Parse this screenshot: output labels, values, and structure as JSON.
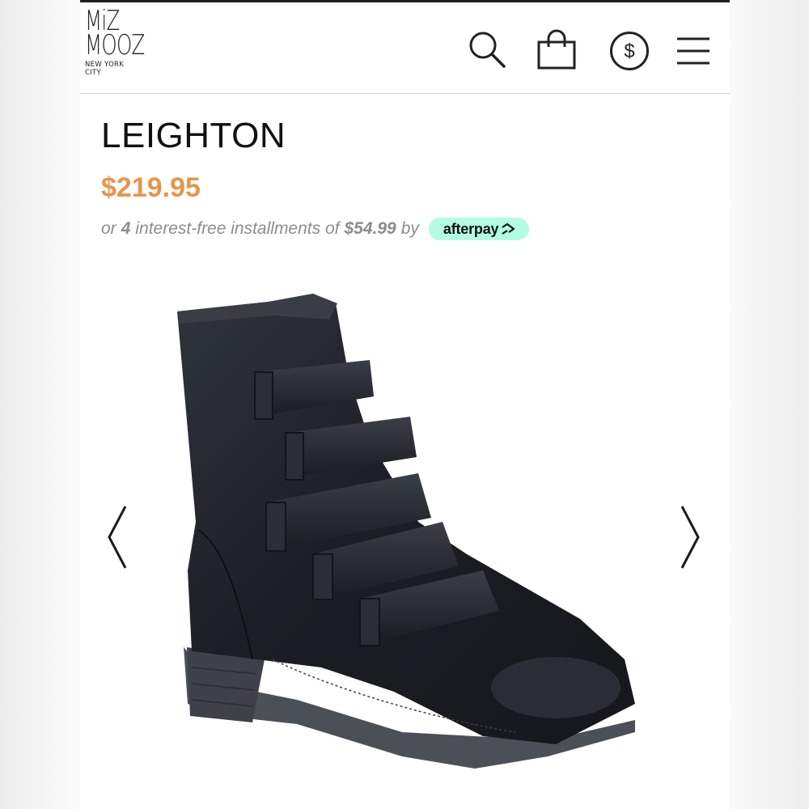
{
  "brand": {
    "logo_line1": "MiZ",
    "logo_line2": "MOOZ",
    "logo_tagline": "NEW YORK CITY"
  },
  "header": {
    "icons": [
      "search-icon",
      "shopping-bag-icon",
      "currency-icon",
      "menu-icon"
    ],
    "currency_symbol": "$"
  },
  "product": {
    "name": "LEIGHTON",
    "price": "$219.95",
    "installments": {
      "prefix": "or",
      "count": "4",
      "middle": "interest-free installments of",
      "amount": "$54.99",
      "suffix": "by",
      "provider": "afterpay"
    }
  },
  "gallery": {
    "prev_icon": "chevron-left-icon",
    "next_icon": "chevron-right-icon"
  },
  "colors": {
    "price": "#e8954a",
    "afterpay_badge": "#b2fce4",
    "text_muted": "#8c8c8c",
    "boot_leather": "#1d1f26"
  }
}
